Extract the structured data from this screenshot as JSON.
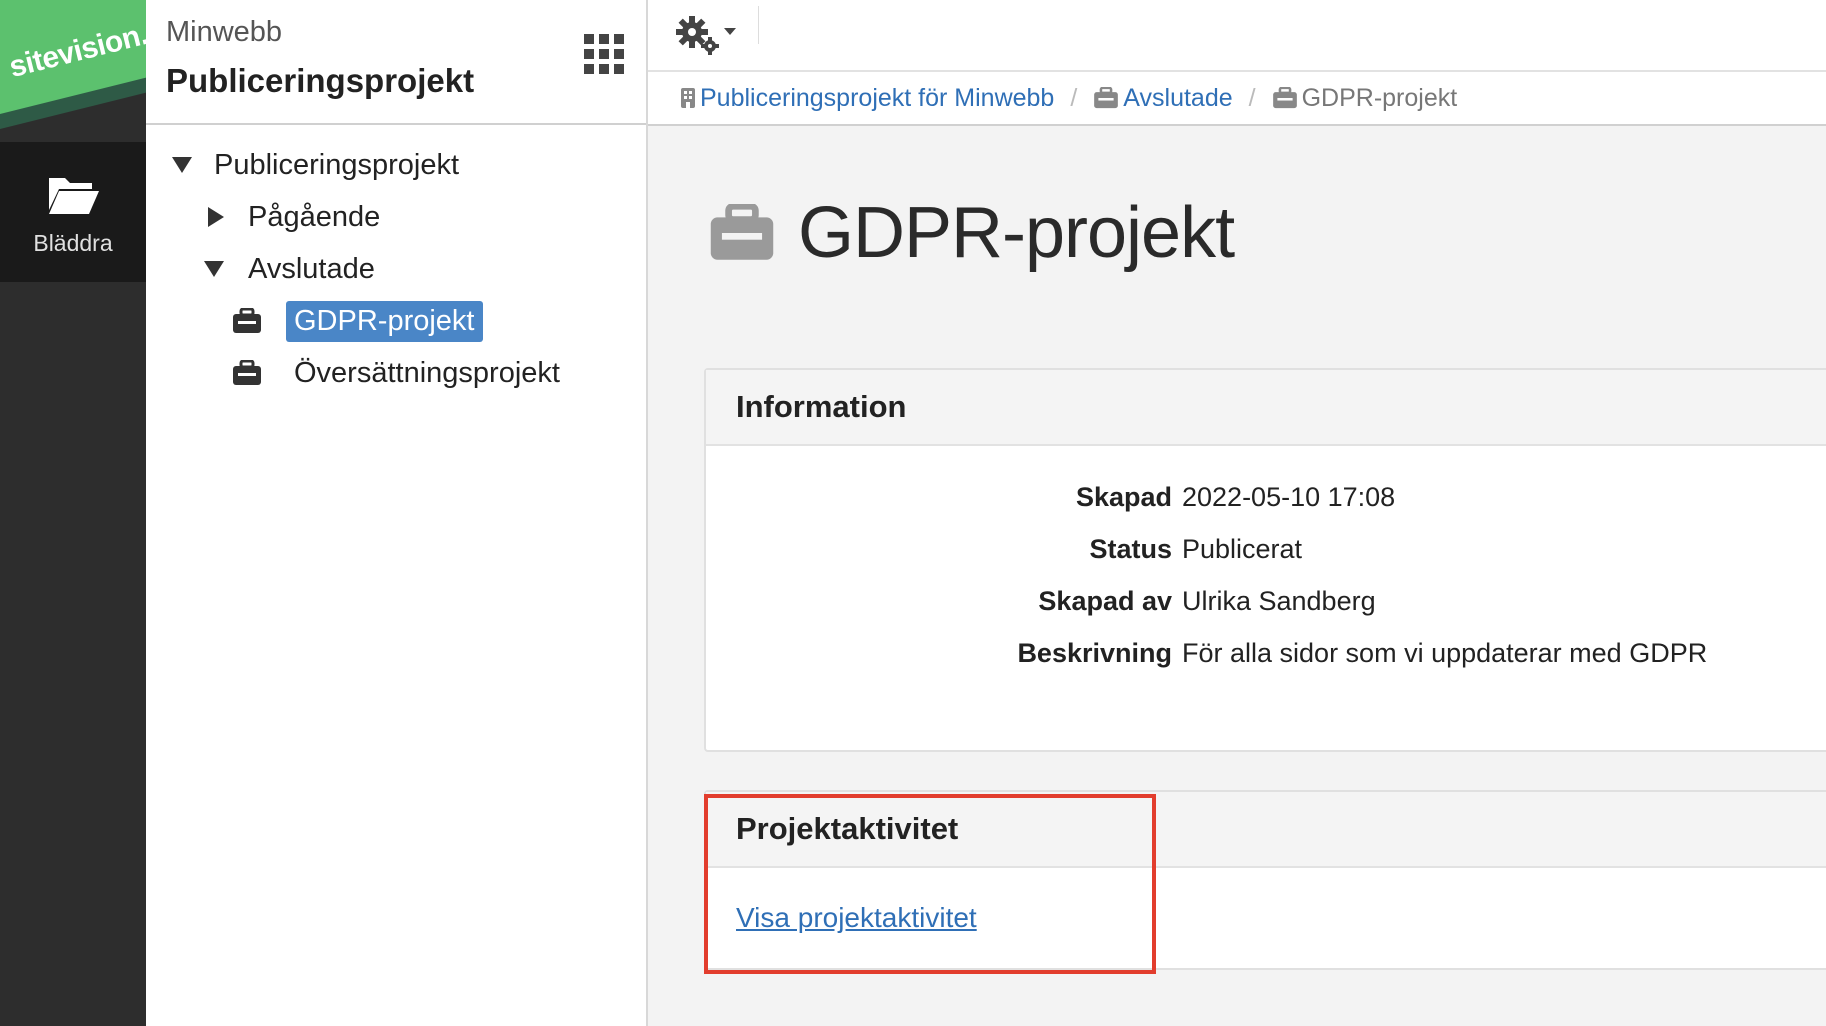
{
  "colors": {
    "brand_green": "#5cc16e",
    "rail_dark": "#2d2d2d",
    "link_blue": "#2f6fb6",
    "selected_bg": "#4a86c7",
    "highlight_red": "#e23d2d"
  },
  "rail": {
    "logo_text": "sitevision.",
    "browse_label": "Bläddra",
    "browse_icon": "folder-open-icon"
  },
  "tree_panel": {
    "site_name": "Minwebb",
    "section_name": "Publiceringsprojekt",
    "apps_icon": "apps-grid-icon",
    "items": [
      {
        "label": "Publiceringsprojekt",
        "expanded": true,
        "level": 0
      },
      {
        "label": "Pågående",
        "expanded": false,
        "level": 1
      },
      {
        "label": "Avslutade",
        "expanded": true,
        "level": 1
      },
      {
        "label": "GDPR-projekt",
        "selected": true,
        "level": 2,
        "icon": "briefcase-icon"
      },
      {
        "label": "Översättningsprojekt",
        "selected": false,
        "level": 2,
        "icon": "briefcase-icon"
      }
    ]
  },
  "toolbar": {
    "settings_icon": "gears-icon"
  },
  "breadcrumb": {
    "items": [
      {
        "label": "Publiceringsprojekt för Minwebb",
        "icon": "building-icon"
      },
      {
        "label": "Avslutade",
        "icon": "briefcase-icon"
      },
      {
        "label": "GDPR-projekt",
        "icon": "briefcase-icon"
      }
    ],
    "separator": "/"
  },
  "main": {
    "title": "GDPR-projekt",
    "title_icon": "briefcase-icon",
    "info": {
      "heading": "Information",
      "rows": [
        {
          "key": "Skapad",
          "value": "2022-05-10 17:08"
        },
        {
          "key": "Status",
          "value": "Publicerat"
        },
        {
          "key": "Skapad av",
          "value": "Ulrika Sandberg"
        },
        {
          "key": "Beskrivning",
          "value": "För alla sidor som vi uppdaterar med GDPR"
        }
      ]
    },
    "activity": {
      "heading": "Projektaktivitet",
      "link_label": "Visa projektaktivitet"
    }
  }
}
